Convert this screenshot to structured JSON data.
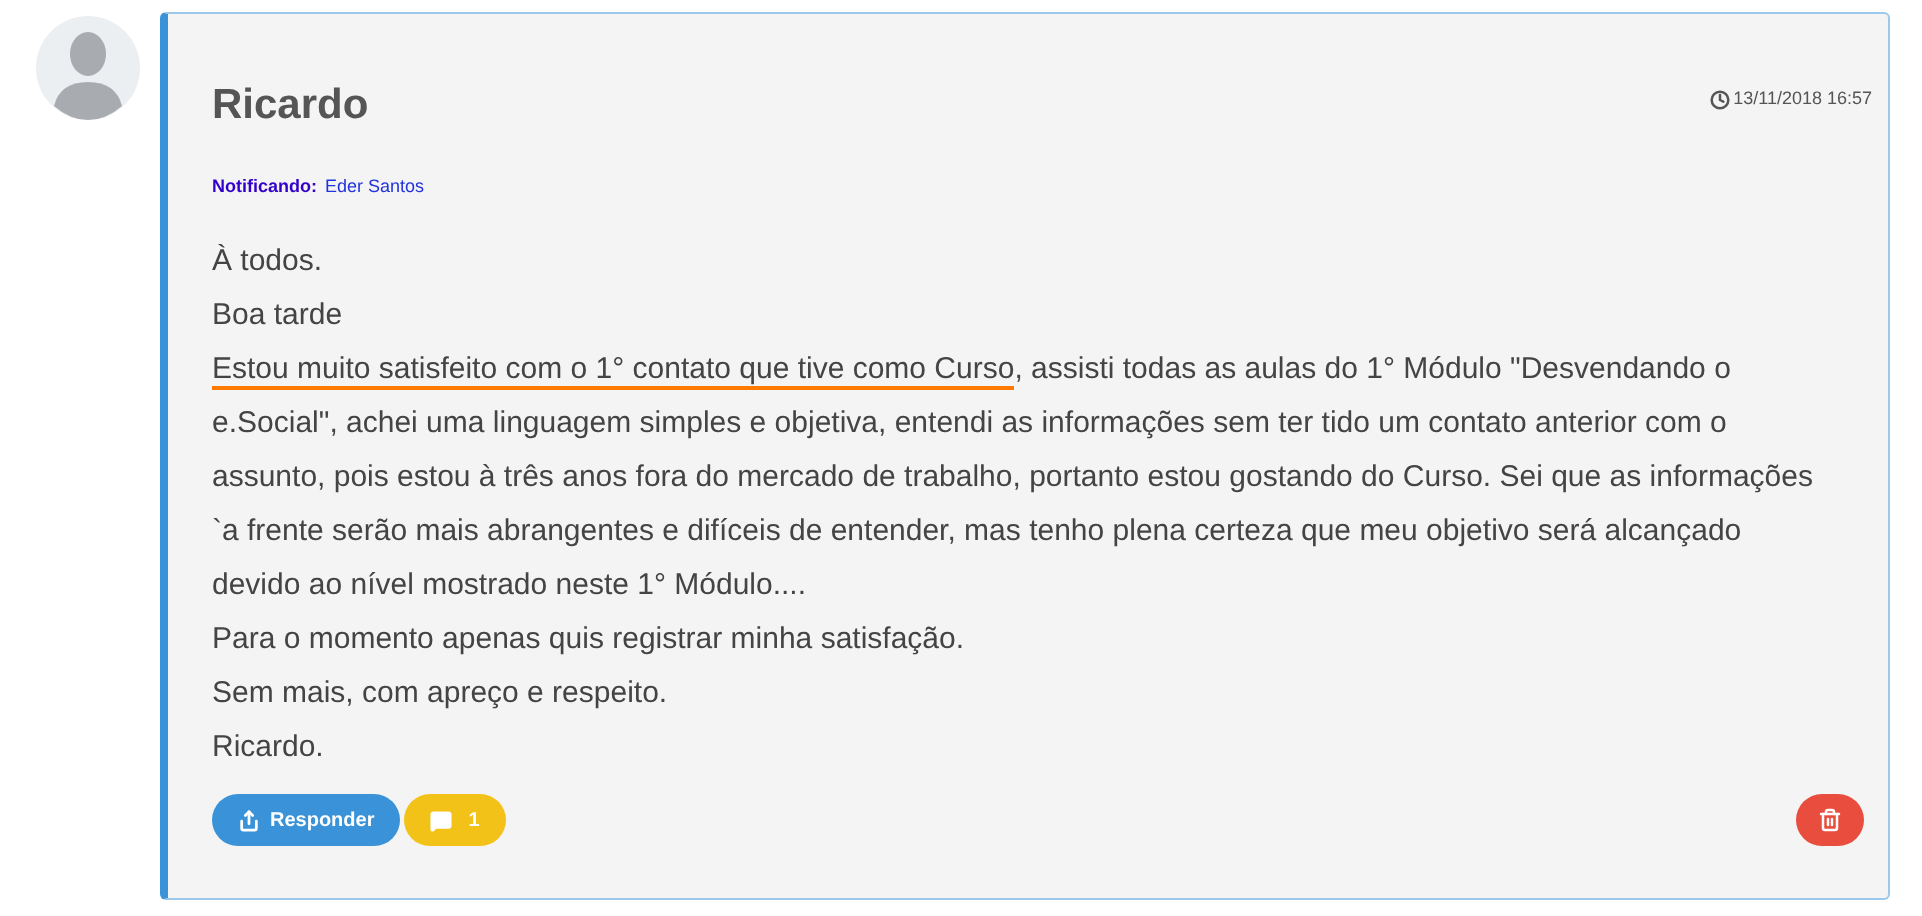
{
  "comment": {
    "author": "Ricardo",
    "timestamp": "13/11/2018 16:57",
    "notify_label": "Notificando:",
    "notify_name": "Eder Santos",
    "body": [
      {
        "kind": "plain",
        "text": "À todos."
      },
      {
        "kind": "plain",
        "text": "Boa tarde"
      },
      {
        "kind": "highlighted",
        "highlight": "Estou muito satisfeito com o 1° contato que tive como Curso",
        "text": ", assisti todas as aulas do 1° Módulo \"Desvendando o e.Social\", achei uma linguagem simples e objetiva, entendi as informações sem ter tido um contato anterior com o assunto, pois estou à três anos fora do mercado de trabalho, portanto estou gostando do Curso. Sei que as informações `a frente serão mais abrangentes e difíceis de entender, mas tenho plena certeza que meu objetivo será alcançado devido ao nível mostrado neste 1° Módulo...."
      },
      {
        "kind": "plain",
        "text": "Para o momento apenas quis registrar minha satisfação."
      },
      {
        "kind": "plain",
        "text": "Sem mais, com apreço e respeito."
      },
      {
        "kind": "plain",
        "text": "Ricardo."
      }
    ],
    "reply_button": "Responder",
    "comments_count": "1"
  }
}
